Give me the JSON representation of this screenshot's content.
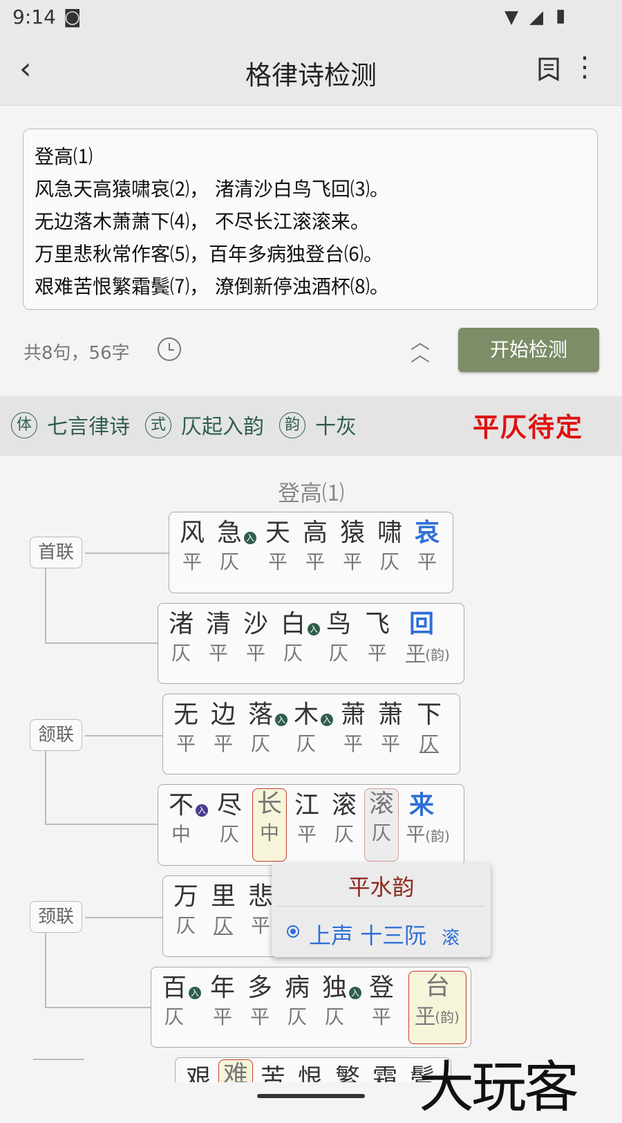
{
  "status": {
    "time": "9:14"
  },
  "appbar": {
    "title": "格律诗检测"
  },
  "input": {
    "lines": [
      "登高⑴",
      "风急天高猿啸哀⑵， 渚清沙白鸟飞回⑶。",
      "无边落木萧萧下⑷， 不尽长江滚滚来。",
      "万里悲秋常作客⑸，百年多病独登台⑹。",
      "艰难苦恨繁霜鬓⑺， 潦倒新停浊酒杯⑻。"
    ]
  },
  "meta": {
    "count": "共8句，56字"
  },
  "buttons": {
    "start": "开始检测"
  },
  "strip": {
    "seal1": "体",
    "form": "七言律诗",
    "seal2": "式",
    "style": "仄起入韵",
    "seal3": "韵",
    "rhyme": "十灰",
    "verdict": "平仄待定"
  },
  "poem": {
    "title": "登高⑴"
  },
  "couplets": {
    "c1": "首联",
    "c2": "颔联",
    "c3": "颈联"
  },
  "lines": [
    {
      "chars": [
        "风",
        "急",
        "天",
        "高",
        "猿",
        "啸",
        "哀"
      ],
      "tones": [
        "平",
        "仄",
        "平",
        "平",
        "平",
        "仄",
        "平"
      ]
    },
    {
      "chars": [
        "渚",
        "清",
        "沙",
        "白",
        "鸟",
        "飞",
        "回"
      ],
      "tones": [
        "仄",
        "平",
        "平",
        "仄",
        "仄",
        "平",
        "平"
      ],
      "yun": "(韵)"
    },
    {
      "chars": [
        "无",
        "边",
        "落",
        "木",
        "萧",
        "萧",
        "下"
      ],
      "tones": [
        "平",
        "平",
        "仄",
        "仄",
        "平",
        "平",
        "仄"
      ]
    },
    {
      "chars": [
        "不",
        "尽",
        "长",
        "江",
        "滚",
        "滚",
        "来"
      ],
      "tones": [
        "中",
        "仄",
        "中",
        "平",
        "仄",
        "仄",
        "平"
      ],
      "yun": "(韵)"
    },
    {
      "chars": [
        "万",
        "里",
        "悲"
      ],
      "tones": [
        "仄",
        "仄",
        "平"
      ]
    },
    {
      "chars": [
        "百",
        "年",
        "多",
        "病",
        "独",
        "登",
        "台"
      ],
      "tones": [
        "仄",
        "平",
        "平",
        "仄",
        "仄",
        "平",
        "平"
      ],
      "yun": "(韵)"
    },
    {
      "chars": [
        "艰",
        "难",
        "苦",
        "恨",
        "繁",
        "霜",
        "鬓"
      ]
    }
  ],
  "ru_label": "入",
  "popup": {
    "title": "平水韵",
    "option": "上声 十三阮",
    "option_char": "滚"
  },
  "watermark": "大玩客"
}
